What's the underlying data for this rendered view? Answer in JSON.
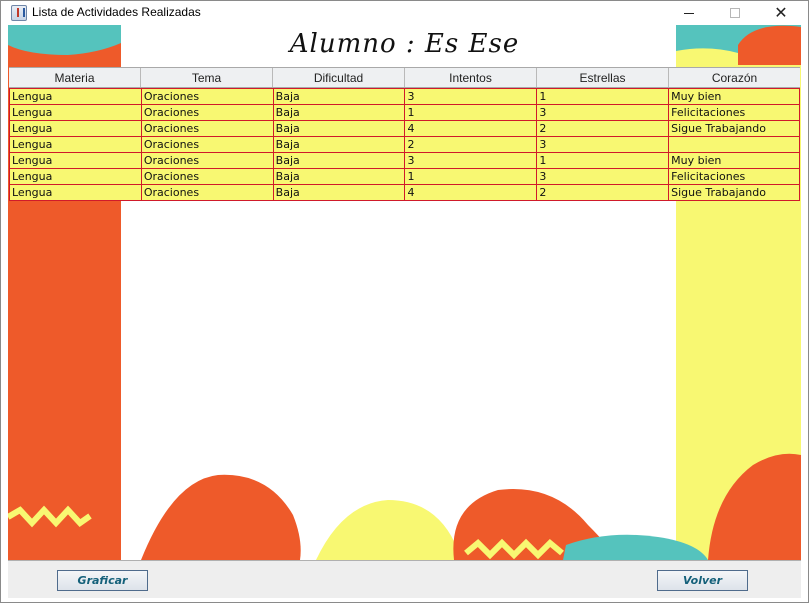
{
  "window": {
    "title": "Lista de Actividades Realizadas",
    "controls": {
      "minimize_icon": "minimize-icon",
      "maximize_icon": "maximize-icon",
      "close_icon": "close-icon",
      "close_glyph": "✕"
    }
  },
  "header": {
    "title": "Alumno : Es Ese"
  },
  "table": {
    "columns": [
      "Materia",
      "Tema",
      "Dificultad",
      "Intentos",
      "Estrellas",
      "Corazón"
    ],
    "rows": [
      [
        "Lengua",
        "Oraciones",
        "Baja",
        "3",
        "1",
        "Muy bien"
      ],
      [
        "Lengua",
        "Oraciones",
        "Baja",
        "1",
        "3",
        "Felicitaciones"
      ],
      [
        "Lengua",
        "Oraciones",
        "Baja",
        "4",
        "2",
        "Sigue Trabajando"
      ],
      [
        "Lengua",
        "Oraciones",
        "Baja",
        "2",
        "3",
        ""
      ],
      [
        "Lengua",
        "Oraciones",
        "Baja",
        "3",
        "1",
        "Muy bien"
      ],
      [
        "Lengua",
        "Oraciones",
        "Baja",
        "1",
        "3",
        "Felicitaciones"
      ],
      [
        "Lengua",
        "Oraciones",
        "Baja",
        "4",
        "2",
        "Sigue Trabajando"
      ]
    ],
    "row_background": "#f8f872",
    "grid_color": "#d01a2a"
  },
  "footer": {
    "graficar_label": "Graficar",
    "volver_label": "Volver"
  },
  "colors": {
    "orange": "#ee5a2a",
    "yellow": "#f8f872",
    "teal": "#55c3bd",
    "button_text": "#14607a"
  }
}
